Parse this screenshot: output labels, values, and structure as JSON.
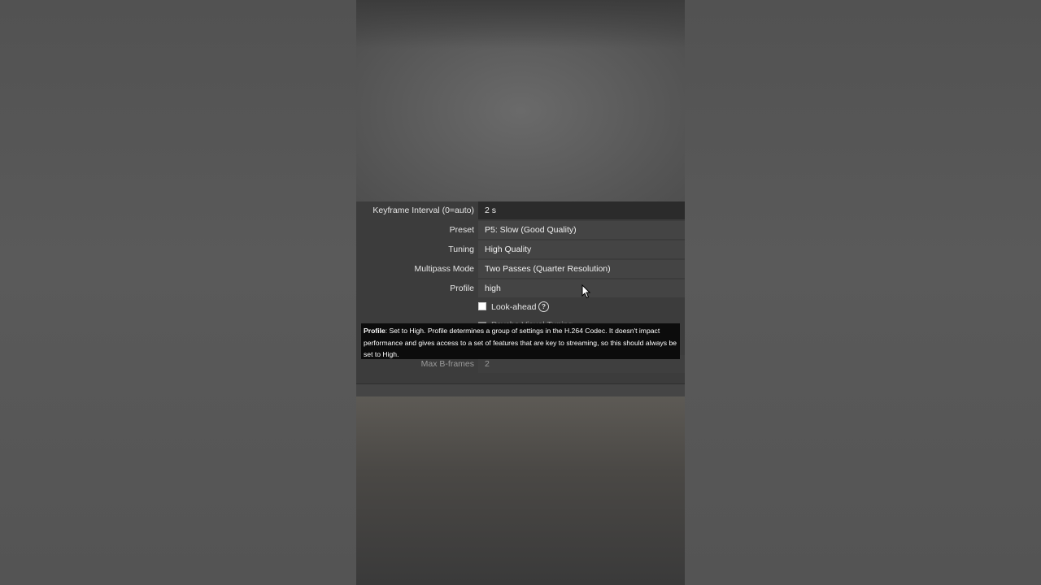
{
  "settings": {
    "keyframe": {
      "label": "Keyframe Interval (0=auto)",
      "value": "2 s"
    },
    "preset": {
      "label": "Preset",
      "value": "P5: Slow (Good Quality)"
    },
    "tuning": {
      "label": "Tuning",
      "value": "High Quality"
    },
    "multipass": {
      "label": "Multipass Mode",
      "value": "Two Passes (Quarter Resolution)"
    },
    "profile": {
      "label": "Profile",
      "value": "high"
    },
    "lookahead": {
      "label": "Look-ahead",
      "checked": false,
      "help_icon": "question-circle-icon"
    },
    "psycho": {
      "label": "Psycho Visual Tuning"
    },
    "bframes": {
      "label": "Max B-frames",
      "value": "2"
    }
  },
  "tooltip": {
    "title": "Profile",
    "text": ": Set to High. Profile determines a group of settings in the H.264 Codec. It doesn't impact performance and gives access to a set of features that are key to streaming, so this should always be set to High."
  },
  "icons": {
    "help": "?",
    "cursor": "mouse-pointer-icon"
  }
}
